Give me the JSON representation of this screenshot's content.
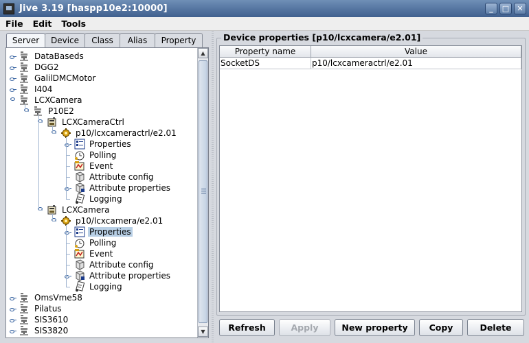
{
  "window": {
    "title": "Jive 3.19  [haspp10e2:10000]",
    "controls": [
      "_",
      "□",
      "✕"
    ]
  },
  "menu": [
    "File",
    "Edit",
    "Tools"
  ],
  "tabs": [
    {
      "label": "Server",
      "active": true
    },
    {
      "label": "Device",
      "active": false
    },
    {
      "label": "Class",
      "active": false
    },
    {
      "label": "Alias",
      "active": false
    },
    {
      "label": "Property",
      "active": false
    }
  ],
  "tree": [
    {
      "label": "DataBaseds",
      "icon": "server-icon",
      "depth": 0,
      "expanded": false
    },
    {
      "label": "DGG2",
      "icon": "server-icon",
      "depth": 0,
      "expanded": false
    },
    {
      "label": "GalilDMCMotor",
      "icon": "server-icon",
      "depth": 0,
      "expanded": false
    },
    {
      "label": "I404",
      "icon": "server-icon",
      "depth": 0,
      "expanded": false
    },
    {
      "label": "LCXCamera",
      "icon": "server-icon",
      "depth": 0,
      "expanded": true
    },
    {
      "label": "P10E2",
      "icon": "server-icon",
      "depth": 1,
      "expanded": true
    },
    {
      "label": "LCXCameraCtrl",
      "icon": "class-icon",
      "depth": 2,
      "expanded": true
    },
    {
      "label": "p10/lcxcameractrl/e2.01",
      "icon": "device-icon",
      "depth": 3,
      "expanded": true
    },
    {
      "label": "Properties",
      "icon": "properties-icon",
      "depth": 4,
      "expanded": false
    },
    {
      "label": "Polling",
      "icon": "polling-icon",
      "depth": 4,
      "leaf": true
    },
    {
      "label": "Event",
      "icon": "event-icon",
      "depth": 4,
      "leaf": true
    },
    {
      "label": "Attribute config",
      "icon": "attribute-config-icon",
      "depth": 4,
      "leaf": true
    },
    {
      "label": "Attribute properties",
      "icon": "attribute-properties-icon",
      "depth": 4,
      "expanded": false
    },
    {
      "label": "Logging",
      "icon": "logging-icon",
      "depth": 4,
      "leaf": true
    },
    {
      "label": "LCXCamera",
      "icon": "class-icon",
      "depth": 2,
      "expanded": true
    },
    {
      "label": "p10/lcxcamera/e2.01",
      "icon": "device-icon",
      "depth": 3,
      "expanded": true
    },
    {
      "label": "Properties",
      "icon": "properties-icon",
      "depth": 4,
      "expanded": false,
      "selected": true
    },
    {
      "label": "Polling",
      "icon": "polling-icon",
      "depth": 4,
      "leaf": true
    },
    {
      "label": "Event",
      "icon": "event-icon",
      "depth": 4,
      "leaf": true
    },
    {
      "label": "Attribute config",
      "icon": "attribute-config-icon",
      "depth": 4,
      "leaf": true
    },
    {
      "label": "Attribute properties",
      "icon": "attribute-properties-icon",
      "depth": 4,
      "expanded": false
    },
    {
      "label": "Logging",
      "icon": "logging-icon",
      "depth": 4,
      "leaf": true
    },
    {
      "label": "OmsVme58",
      "icon": "server-icon",
      "depth": 0,
      "expanded": false
    },
    {
      "label": "Pilatus",
      "icon": "server-icon",
      "depth": 0,
      "expanded": false
    },
    {
      "label": "SIS3610",
      "icon": "server-icon",
      "depth": 0,
      "expanded": false
    },
    {
      "label": "SIS3820",
      "icon": "server-icon",
      "depth": 0,
      "expanded": false
    }
  ],
  "panel": {
    "title": "Device properties [p10/lcxcamera/e2.01]",
    "columns": [
      "Property name",
      "Value"
    ],
    "rows": [
      [
        "SocketDS",
        "p10/lcxcameractrl/e2.01"
      ]
    ]
  },
  "buttons": [
    {
      "label": "Refresh",
      "enabled": true
    },
    {
      "label": "Apply",
      "enabled": false
    },
    {
      "label": "New property",
      "enabled": true
    },
    {
      "label": "Copy",
      "enabled": true
    },
    {
      "label": "Delete",
      "enabled": true
    }
  ]
}
